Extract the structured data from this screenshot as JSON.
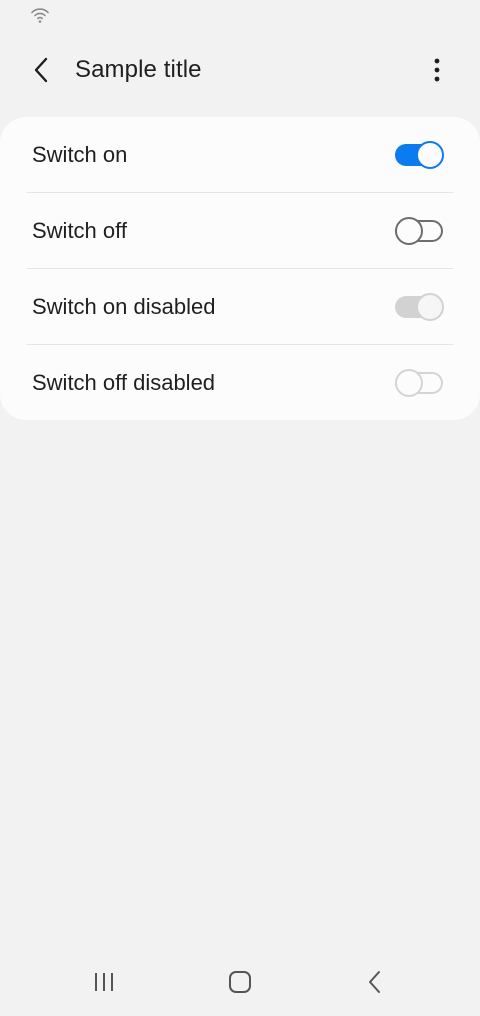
{
  "status_bar": {
    "wifi_icon": "wifi-icon"
  },
  "app_bar": {
    "back_icon": "chevron-left-icon",
    "title": "Sample title",
    "more_icon": "more-vertical-icon"
  },
  "settings": {
    "items": [
      {
        "label": "Switch on",
        "checked": true,
        "disabled": false
      },
      {
        "label": "Switch off",
        "checked": false,
        "disabled": false
      },
      {
        "label": "Switch on disabled",
        "checked": true,
        "disabled": true
      },
      {
        "label": "Switch off disabled",
        "checked": false,
        "disabled": true
      }
    ]
  },
  "nav_bar": {
    "recents_icon": "recents-icon",
    "home_icon": "home-icon",
    "back_icon": "back-icon"
  },
  "colors": {
    "accent": "#0a7cf0",
    "background": "#f2f2f2",
    "card": "#fcfcfc",
    "switch_off_border": "#6e6e6e",
    "disabled": "#d2d2d2"
  }
}
